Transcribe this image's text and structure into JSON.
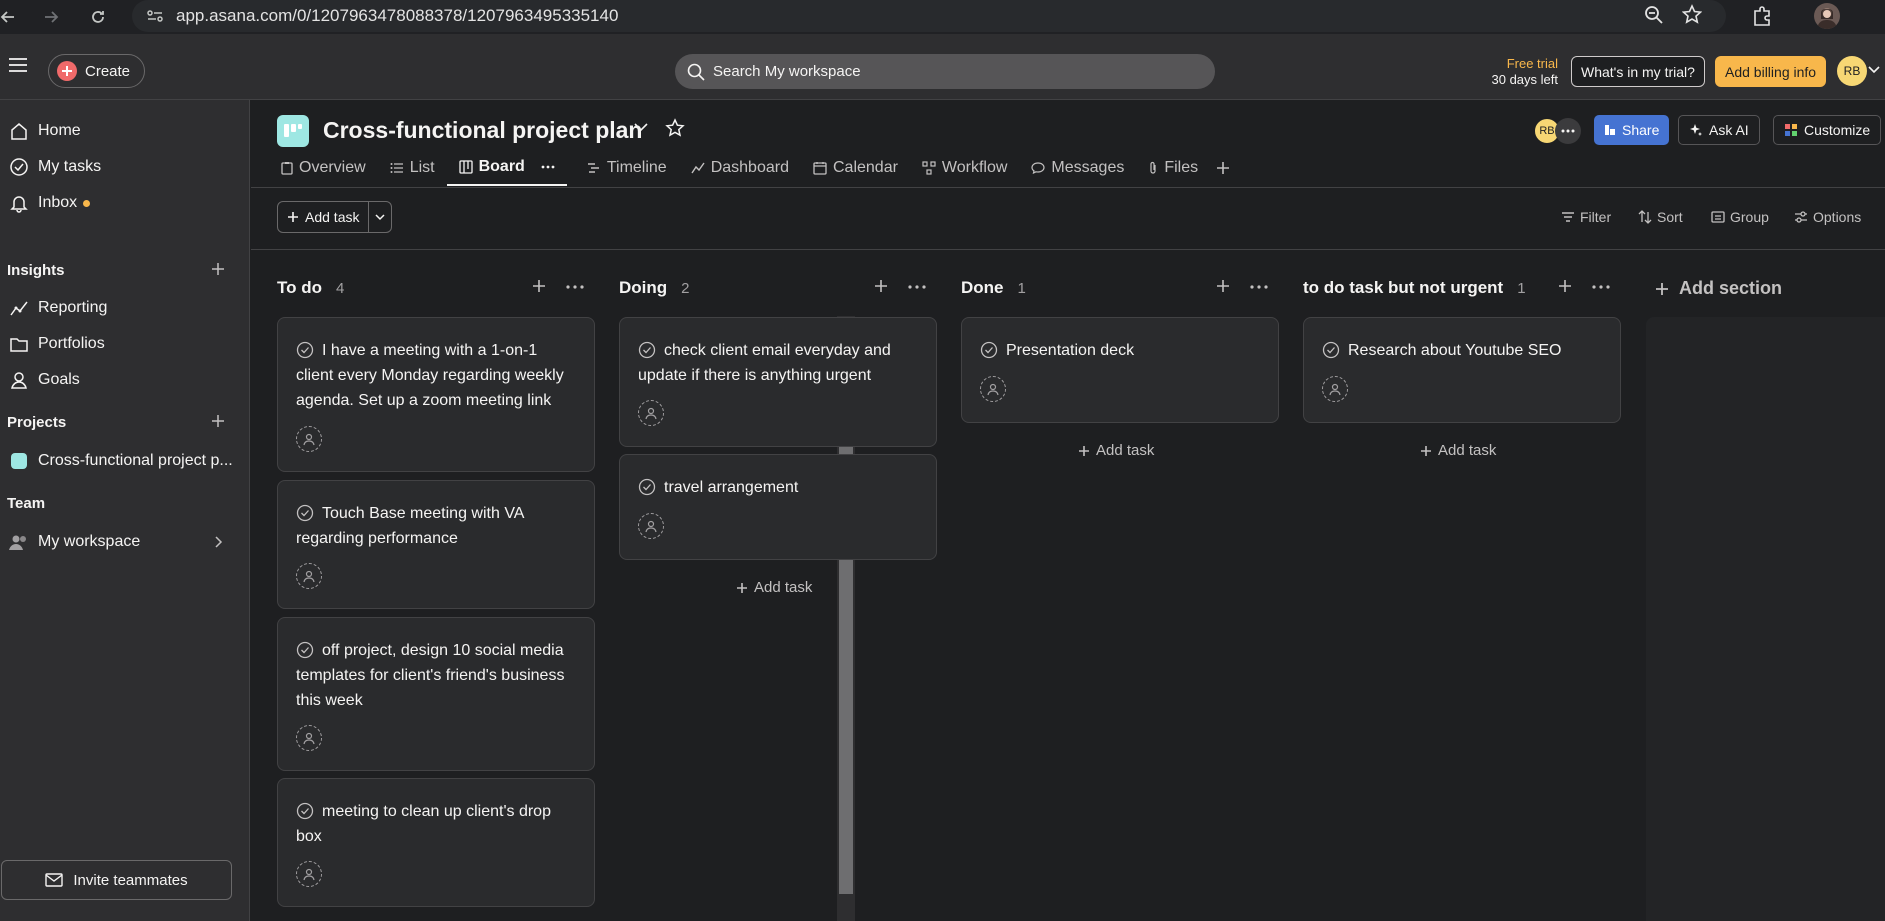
{
  "browser": {
    "url": "app.asana.com/0/1207963478088378/1207963495335140"
  },
  "topbar": {
    "create_label": "Create",
    "search_placeholder": "Search My workspace",
    "trial_line1": "Free trial",
    "trial_line2": "30 days left",
    "trial_button": "What's in my trial?",
    "billing_button": "Add billing info",
    "avatar_initials": "RB"
  },
  "sidebar": {
    "home": "Home",
    "my_tasks": "My tasks",
    "inbox": "Inbox",
    "insights_header": "Insights",
    "reporting": "Reporting",
    "portfolios": "Portfolios",
    "goals": "Goals",
    "projects_header": "Projects",
    "project_item": "Cross-functional project p...",
    "team_header": "Team",
    "my_workspace": "My workspace",
    "invite": "Invite teammates"
  },
  "project": {
    "title": "Cross-functional project plan",
    "avatar_initials": "RB",
    "share": "Share",
    "ask_ai": "Ask AI",
    "customize": "Customize",
    "tabs": [
      "Overview",
      "List",
      "Board",
      "Timeline",
      "Dashboard",
      "Calendar",
      "Workflow",
      "Messages",
      "Files"
    ]
  },
  "toolbar": {
    "add_task": "Add task",
    "filter": "Filter",
    "sort": "Sort",
    "group": "Group",
    "options": "Options"
  },
  "board": {
    "add_task_label": "Add task",
    "add_section": "Add section",
    "columns": [
      {
        "name": "To do",
        "count": "4",
        "cards": [
          "I have a meeting with a 1-on-1 client every Monday regarding weekly agenda. Set up a zoom meeting link",
          "Touch Base meeting with VA regarding performance",
          "off project, design 10 social media templates for client's friend's business this week",
          "meeting to clean up client's drop box"
        ]
      },
      {
        "name": "Doing",
        "count": "2",
        "cards": [
          "check client email everyday and update if there is anything urgent",
          "travel arrangement"
        ]
      },
      {
        "name": "Done",
        "count": "1",
        "cards": [
          "Presentation deck"
        ]
      },
      {
        "name": "to do task but not urgent",
        "count": "1",
        "cards": [
          "Research about Youtube SEO"
        ]
      }
    ]
  }
}
